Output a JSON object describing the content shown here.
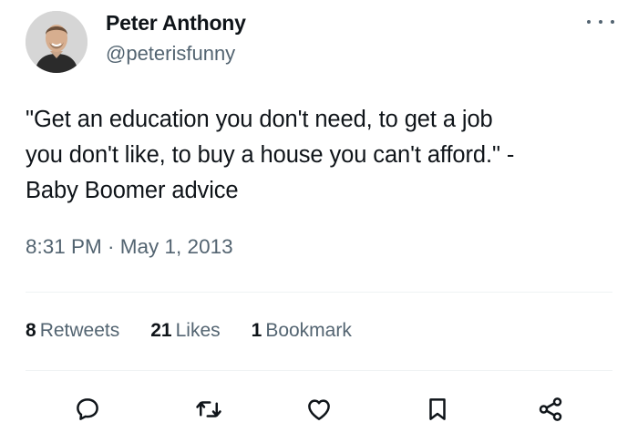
{
  "author": {
    "display_name": "Peter Anthony",
    "handle": "@peterisfunny"
  },
  "tweet": {
    "lines": [
      "\"Get an education you don't need, to get a job",
      "you don't like, to buy a house you can't afford.\" -",
      "Baby Boomer advice"
    ],
    "timestamp": "8:31 PM · May 1, 2013"
  },
  "stats": {
    "retweets": {
      "count": "8",
      "label": "Retweets"
    },
    "likes": {
      "count": "21",
      "label": "Likes"
    },
    "bookmarks": {
      "count": "1",
      "label": "Bookmark"
    }
  },
  "actions": [
    "reply-icon",
    "retweet-icon",
    "like-icon",
    "bookmark-icon",
    "share-icon"
  ],
  "colors": {
    "text_primary": "#0f1419",
    "text_secondary": "#536471",
    "divider": "#eff3f4"
  }
}
